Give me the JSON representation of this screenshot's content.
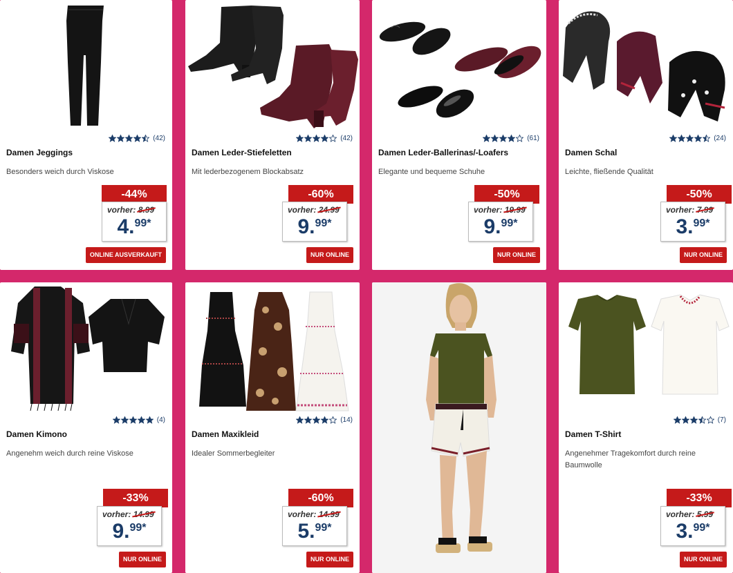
{
  "products": [
    {
      "name": "Damen Jeggings",
      "desc": "Besonders weich durch Viskose",
      "stars": 4.5,
      "reviews": "(42)",
      "badge": "-44%",
      "vorher_label": "vorher:",
      "old": "8.99",
      "int": "4.",
      "dec": "99*",
      "tag": "ONLINE AUSVERKAUFT",
      "image": "jeggings"
    },
    {
      "name": "Damen Leder-Stiefeletten",
      "desc": "Mit lederbezogenem Blockabsatz",
      "stars": 4,
      "reviews": "(42)",
      "badge": "-60%",
      "vorher_label": "vorher:",
      "old": "24.99",
      "int": "9.",
      "dec": "99*",
      "tag": "NUR ONLINE",
      "image": "boots"
    },
    {
      "name": "Damen Leder-Ballerinas/-Loafers",
      "desc": "Elegante und bequeme Schuhe",
      "stars": 4,
      "reviews": "(61)",
      "badge": "-50%",
      "vorher_label": "vorher:",
      "old": "19.99",
      "int": "9.",
      "dec": "99*",
      "tag": "NUR ONLINE",
      "image": "ballerinas"
    },
    {
      "name": "Damen Schal",
      "desc": "Leichte, fließende Qualität",
      "stars": 4.5,
      "reviews": "(24)",
      "badge": "-50%",
      "vorher_label": "vorher:",
      "old": "7.99",
      "int": "3.",
      "dec": "99*",
      "tag": "NUR ONLINE",
      "image": "scarf"
    },
    {
      "name": "Damen Kimono",
      "desc": "Angenehm weich durch reine Viskose",
      "stars": 5,
      "reviews": "(4)",
      "badge": "-33%",
      "vorher_label": "vorher:",
      "old": "14.99",
      "int": "9.",
      "dec": "99*",
      "tag": "NUR ONLINE",
      "image": "kimono"
    },
    {
      "name": "Damen Maxikleid",
      "desc": "Idealer Sommerbegleiter",
      "stars": 4,
      "reviews": "(14)",
      "badge": "-60%",
      "vorher_label": "vorher:",
      "old": "14.99",
      "int": "5.",
      "dec": "99*",
      "tag": "NUR ONLINE",
      "image": "dresses"
    },
    {
      "image": "model"
    },
    {
      "name": "Damen T-Shirt",
      "desc": "Angenehmer Tragekomfort durch reine Baumwolle",
      "stars": 3.5,
      "reviews": "(7)",
      "badge": "-33%",
      "vorher_label": "vorher:",
      "old": "5.99",
      "int": "3.",
      "dec": "99*",
      "tag": "NUR ONLINE",
      "image": "tshirts"
    }
  ],
  "colors": {
    "accent": "#d4286b",
    "badge": "#c51a1a",
    "price": "#1b3c68"
  }
}
